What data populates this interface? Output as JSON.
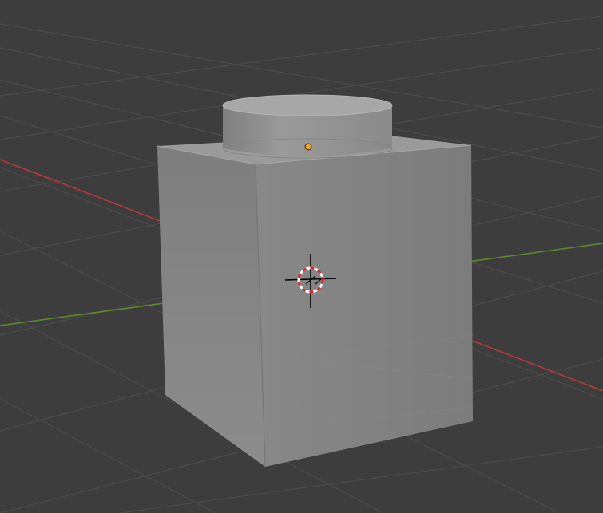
{
  "viewport": {
    "background_color": "#3d3d3d",
    "grid_color": "#4a4a4a",
    "x_axis_color": "#c0393b",
    "y_axis_color": "#5f8f2c"
  },
  "scene": {
    "objects": [
      {
        "name": "cube",
        "color_front": "#808080",
        "color_side": "#8c8c8c",
        "color_top": "#9a9a9a"
      },
      {
        "name": "cylinder",
        "color_side": "#8e8e8e",
        "color_top": "#a6a6a6"
      }
    ],
    "origin_dot_color": "#f0a030",
    "cursor_colors": [
      "#ffffff",
      "#d42a2a",
      "#000000"
    ],
    "icons": [
      "3d-cursor-icon",
      "origin-dot-icon"
    ]
  }
}
